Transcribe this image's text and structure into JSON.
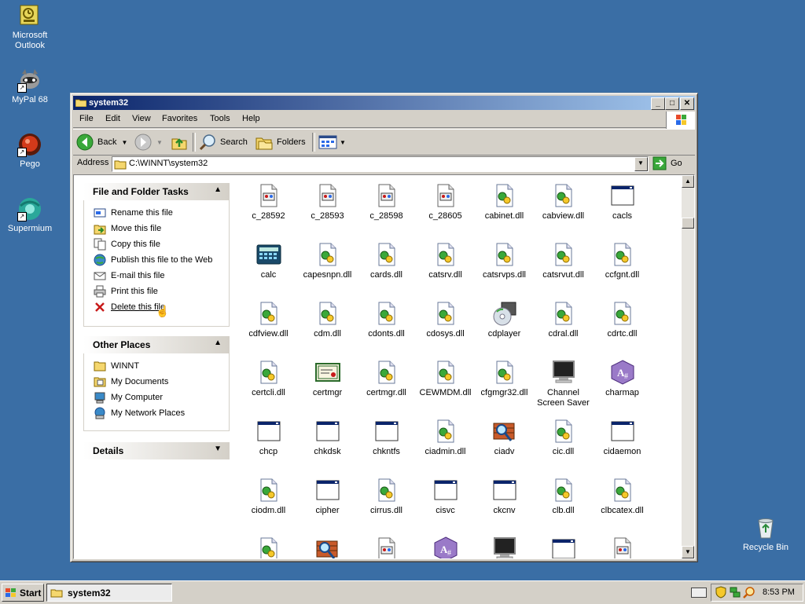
{
  "desktop": {
    "icons": [
      {
        "label_1": "Microsoft",
        "label_2": "Outlook"
      },
      {
        "label_1": "MyPal 68"
      },
      {
        "label_1": "Pego"
      },
      {
        "label_1": "Supermium"
      },
      {
        "label_1": "Recycle Bin"
      }
    ]
  },
  "window": {
    "title": "system32",
    "menu": [
      "File",
      "Edit",
      "View",
      "Favorites",
      "Tools",
      "Help"
    ],
    "toolbar": {
      "back": "Back",
      "search": "Search",
      "folders": "Folders"
    },
    "address": {
      "label": "Address",
      "value": "C:\\WINNT\\system32",
      "go": "Go"
    }
  },
  "tasks": {
    "file_folder": {
      "title": "File and Folder Tasks",
      "items": [
        "Rename this file",
        "Move this file",
        "Copy this file",
        "Publish this file to the Web",
        "E-mail this file",
        "Print this file",
        "Delete this file"
      ]
    },
    "other_places": {
      "title": "Other Places",
      "items": [
        "WINNT",
        "My Documents",
        "My Computer",
        "My Network Places"
      ]
    },
    "details": {
      "title": "Details"
    }
  },
  "files": [
    {
      "name": "c_28592",
      "icon": "nls-icon"
    },
    {
      "name": "c_28593",
      "icon": "nls-icon"
    },
    {
      "name": "c_28598",
      "icon": "nls-icon"
    },
    {
      "name": "c_28605",
      "icon": "nls-icon"
    },
    {
      "name": "cabinet.dll",
      "icon": "dll-icon"
    },
    {
      "name": "cabview.dll",
      "icon": "dll-icon"
    },
    {
      "name": "cacls",
      "icon": "app-icon"
    },
    {
      "name": "calc",
      "icon": "calculator-icon"
    },
    {
      "name": "capesnpn.dll",
      "icon": "dll-icon"
    },
    {
      "name": "cards.dll",
      "icon": "dll-icon"
    },
    {
      "name": "catsrv.dll",
      "icon": "dll-icon"
    },
    {
      "name": "catsrvps.dll",
      "icon": "dll-icon"
    },
    {
      "name": "catsrvut.dll",
      "icon": "dll-icon"
    },
    {
      "name": "ccfgnt.dll",
      "icon": "dll-icon"
    },
    {
      "name": "cdfview.dll",
      "icon": "dll-icon"
    },
    {
      "name": "cdm.dll",
      "icon": "dll-icon"
    },
    {
      "name": "cdonts.dll",
      "icon": "dll-icon"
    },
    {
      "name": "cdosys.dll",
      "icon": "dll-icon"
    },
    {
      "name": "cdplayer",
      "icon": "cd-icon"
    },
    {
      "name": "cdral.dll",
      "icon": "dll-icon"
    },
    {
      "name": "cdrtc.dll",
      "icon": "dll-icon"
    },
    {
      "name": "certcli.dll",
      "icon": "dll-icon"
    },
    {
      "name": "certmgr",
      "icon": "certificate-icon"
    },
    {
      "name": "certmgr.dll",
      "icon": "dll-icon"
    },
    {
      "name": "CEWMDM.dll",
      "icon": "dll-icon"
    },
    {
      "name": "cfgmgr32.dll",
      "icon": "dll-icon"
    },
    {
      "name": "Channel Screen Saver",
      "icon": "monitor-icon"
    },
    {
      "name": "charmap",
      "icon": "charmap-icon"
    },
    {
      "name": "chcp",
      "icon": "app-icon"
    },
    {
      "name": "chkdsk",
      "icon": "app-icon"
    },
    {
      "name": "chkntfs",
      "icon": "app-icon"
    },
    {
      "name": "ciadmin.dll",
      "icon": "dll-icon"
    },
    {
      "name": "ciadv",
      "icon": "index-icon"
    },
    {
      "name": "cic.dll",
      "icon": "dll-icon"
    },
    {
      "name": "cidaemon",
      "icon": "app-icon"
    },
    {
      "name": "ciodm.dll",
      "icon": "dll-icon"
    },
    {
      "name": "cipher",
      "icon": "app-icon"
    },
    {
      "name": "cirrus.dll",
      "icon": "dll-icon"
    },
    {
      "name": "cisvc",
      "icon": "app-icon"
    },
    {
      "name": "ckcnv",
      "icon": "app-icon"
    },
    {
      "name": "clb.dll",
      "icon": "dll-icon"
    },
    {
      "name": "clbcatex.dll",
      "icon": "dll-icon"
    }
  ],
  "taskbar": {
    "start": "Start",
    "task": "system32",
    "clock": "8:53 PM"
  }
}
